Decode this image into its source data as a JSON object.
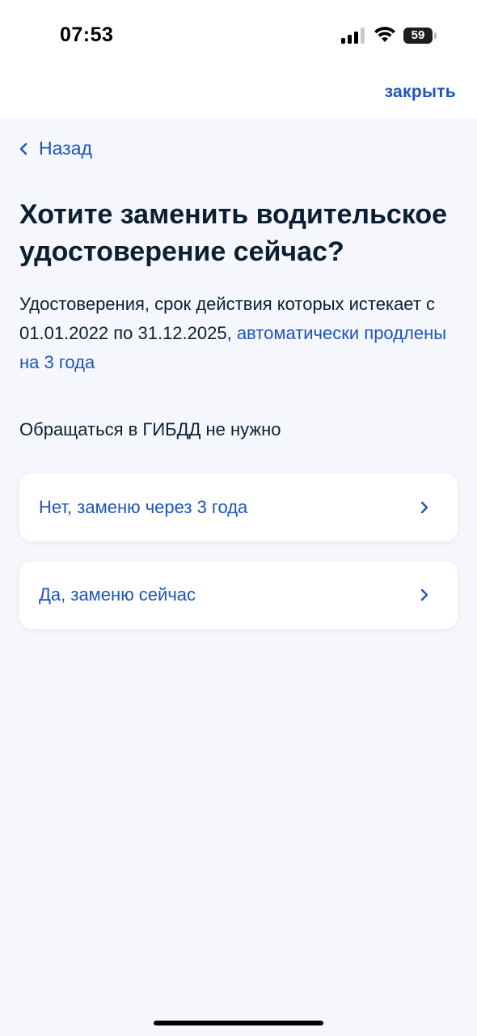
{
  "status_bar": {
    "time": "07:53",
    "battery": "59"
  },
  "header": {
    "close_label": "закрыть"
  },
  "nav": {
    "back_label": "Назад"
  },
  "main": {
    "title": "Хотите заменить водительское удостоверение сейчас?",
    "description_text": "Удостоверения, срок действия которых истекает с 01.01.2022 по 31.12.2025, ",
    "description_link": "автоматически продлены на 3 года",
    "note": "Обращаться в ГИБДД не нужно",
    "options": [
      {
        "label": "Нет, заменю через 3 года"
      },
      {
        "label": "Да, заменю сейчас"
      }
    ]
  },
  "colors": {
    "accent": "#1d55b8",
    "text": "#0b1f33",
    "background": "#f5f7fc",
    "card": "#ffffff"
  }
}
